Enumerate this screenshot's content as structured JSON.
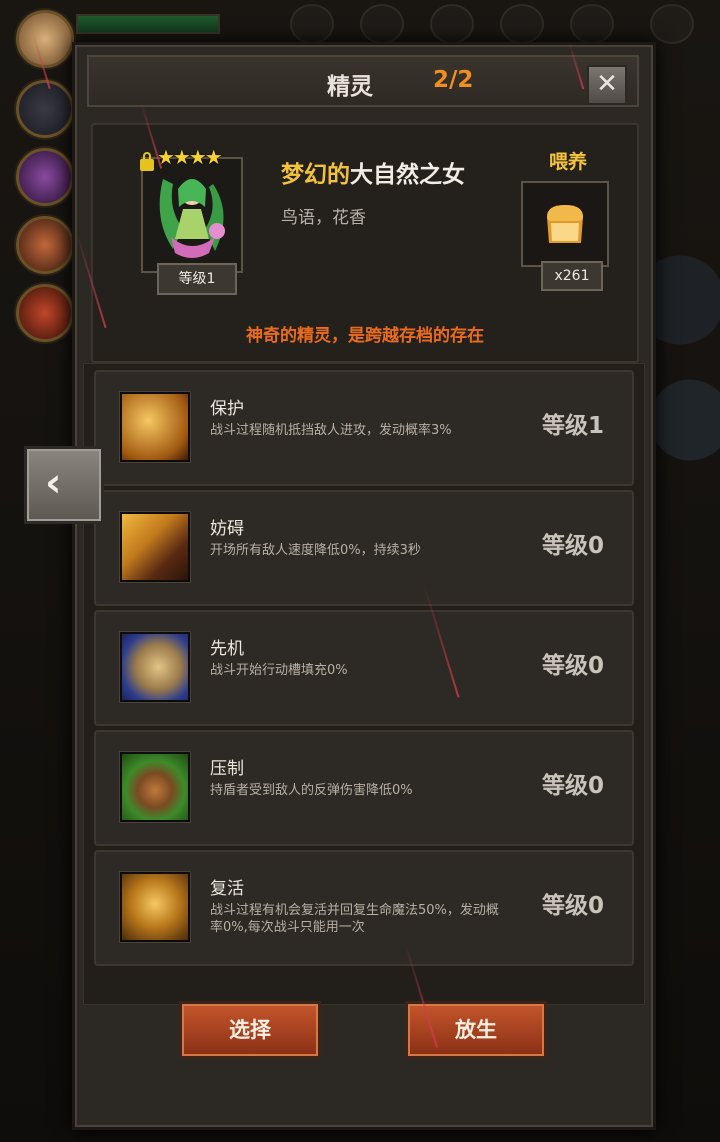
{
  "colors": {
    "accent_orange": "#f08e1e",
    "gold": "#f2c23a",
    "desc_orange": "#ea6b1e",
    "button_red": "#b3461f",
    "panel": "#2c2823"
  },
  "panel": {
    "title": "精灵",
    "count": "2/2",
    "close_icon": "close-icon"
  },
  "spirit": {
    "stars": "★★★★",
    "star_count": 4,
    "locked": true,
    "level_label": "等级1",
    "name_prefix": "梦幻的",
    "name_main": "大自然之女",
    "tags": "鸟语，花香",
    "description": "神奇的精灵，是跨越存档的存在",
    "portrait_icon": "nature-fairy-portrait"
  },
  "feed": {
    "label": "喂养",
    "icon": "bread-icon",
    "count": "x261"
  },
  "skills": [
    {
      "name": "保护",
      "desc": "战斗过程随机抵挡敌人进攻，发动概率3%",
      "level": "等级1",
      "icon": "protect-skill-icon"
    },
    {
      "name": "妨碍",
      "desc": "开场所有敌人速度降低0%，持续3秒",
      "level": "等级0",
      "icon": "hinder-skill-icon"
    },
    {
      "name": "先机",
      "desc": "战斗开始行动槽填充0%",
      "level": "等级0",
      "icon": "initiative-skill-icon"
    },
    {
      "name": "压制",
      "desc": "持盾者受到敌人的反弹伤害降低0%",
      "level": "等级0",
      "icon": "suppress-skill-icon"
    },
    {
      "name": "复活",
      "desc": "战斗过程有机会复活并回复生命魔法50%，发动概率0%,每次战斗只能用一次",
      "level": "等级0",
      "icon": "revive-skill-icon"
    }
  ],
  "buttons": {
    "select": "选择",
    "release": "放生"
  },
  "nav": {
    "back_icon": "chevron-left-icon",
    "back_glyph": "‹"
  }
}
